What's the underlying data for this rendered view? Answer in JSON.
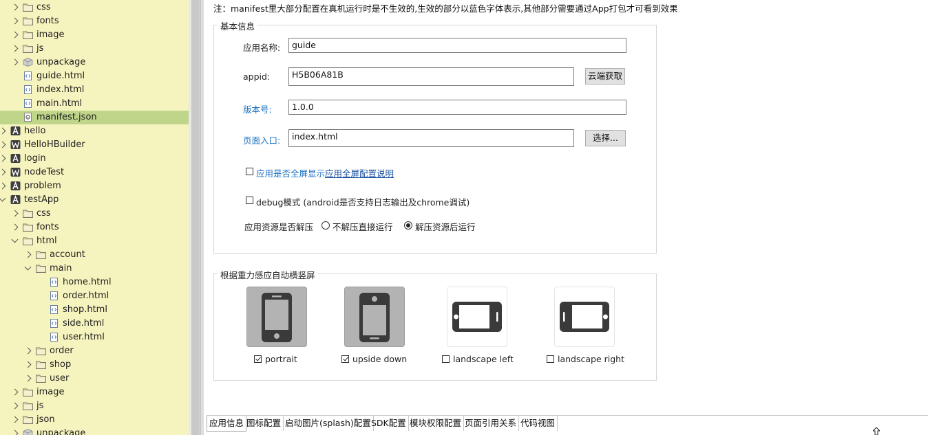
{
  "tree": {
    "items": [
      {
        "label": "css",
        "icon": "folder",
        "depth": 1,
        "arrow": "right"
      },
      {
        "label": "fonts",
        "icon": "folder",
        "depth": 1,
        "arrow": "right"
      },
      {
        "label": "image",
        "icon": "folder",
        "depth": 1,
        "arrow": "right"
      },
      {
        "label": "js",
        "icon": "folder",
        "depth": 1,
        "arrow": "right"
      },
      {
        "label": "unpackage",
        "icon": "package",
        "depth": 1,
        "arrow": "right"
      },
      {
        "label": "guide.html",
        "icon": "html-file",
        "depth": 1,
        "arrow": "none"
      },
      {
        "label": "index.html",
        "icon": "html-file",
        "depth": 1,
        "arrow": "none"
      },
      {
        "label": "main.html",
        "icon": "html-file",
        "depth": 1,
        "arrow": "none"
      },
      {
        "label": "manifest.json",
        "icon": "json-file",
        "depth": 1,
        "arrow": "none",
        "selected": true
      },
      {
        "label": "hello",
        "icon": "app-project",
        "depth": 0,
        "arrow": "right"
      },
      {
        "label": "HelloHBuilder",
        "icon": "web-project",
        "depth": 0,
        "arrow": "right"
      },
      {
        "label": "login",
        "icon": "app-project",
        "depth": 0,
        "arrow": "right"
      },
      {
        "label": "nodeTest",
        "icon": "web-project",
        "depth": 0,
        "arrow": "right"
      },
      {
        "label": "problem",
        "icon": "app-project",
        "depth": 0,
        "arrow": "right"
      },
      {
        "label": "testApp",
        "icon": "app-project",
        "depth": 0,
        "arrow": "down"
      },
      {
        "label": "css",
        "icon": "folder",
        "depth": 1,
        "arrow": "right"
      },
      {
        "label": "fonts",
        "icon": "folder",
        "depth": 1,
        "arrow": "right"
      },
      {
        "label": "html",
        "icon": "folder",
        "depth": 1,
        "arrow": "down"
      },
      {
        "label": "account",
        "icon": "folder",
        "depth": 2,
        "arrow": "right"
      },
      {
        "label": "main",
        "icon": "folder",
        "depth": 2,
        "arrow": "down"
      },
      {
        "label": "home.html",
        "icon": "html-file",
        "depth": 3,
        "arrow": "none"
      },
      {
        "label": "order.html",
        "icon": "html-file",
        "depth": 3,
        "arrow": "none"
      },
      {
        "label": "shop.html",
        "icon": "html-file",
        "depth": 3,
        "arrow": "none"
      },
      {
        "label": "side.html",
        "icon": "html-file",
        "depth": 3,
        "arrow": "none"
      },
      {
        "label": "user.html",
        "icon": "html-file",
        "depth": 3,
        "arrow": "none"
      },
      {
        "label": "order",
        "icon": "folder",
        "depth": 2,
        "arrow": "right"
      },
      {
        "label": "shop",
        "icon": "folder",
        "depth": 2,
        "arrow": "right"
      },
      {
        "label": "user",
        "icon": "folder",
        "depth": 2,
        "arrow": "right"
      },
      {
        "label": "image",
        "icon": "folder",
        "depth": 1,
        "arrow": "right"
      },
      {
        "label": "js",
        "icon": "folder",
        "depth": 1,
        "arrow": "right"
      },
      {
        "label": "json",
        "icon": "folder",
        "depth": 1,
        "arrow": "right"
      },
      {
        "label": "unpackage",
        "icon": "package",
        "depth": 1,
        "arrow": "right"
      }
    ]
  },
  "editor": {
    "note": "注：manifest里大部分配置在真机运行时是不生效的,生效的部分以蓝色字体表示,其他部分需要通过App打包才可看到效果",
    "basic": {
      "legend": "基本信息",
      "app_name_label": "应用名称:",
      "app_name_value": "guide",
      "appid_label": "appid:",
      "appid_value": "H5B06A81B",
      "cloud_button": "云端获取",
      "version_label": "版本号:",
      "version_value": "1.0.0",
      "entry_label": "页面入口:",
      "entry_value": "index.html",
      "choose_button": "选择...",
      "fullscreen_label": "应用是否全屏显示",
      "fullscreen_checked": false,
      "fullscreen_link": "应用全屏配置说明",
      "debug_label": "debug模式 (android是否支持日志输出及chrome调试)",
      "debug_checked": false,
      "unzip_label": "应用资源是否解压",
      "unzip_options": [
        "不解压直接运行",
        "解压资源后运行"
      ],
      "unzip_selected": "解压资源后运行"
    },
    "orientation": {
      "legend": "根据重力感应自动横竖屏",
      "options": [
        {
          "label": "portrait",
          "checked": true,
          "icon": "phone-portrait-icon"
        },
        {
          "label": "upside down",
          "checked": true,
          "icon": "phone-upside-down-icon"
        },
        {
          "label": "landscape left",
          "checked": false,
          "icon": "phone-landscape-left-icon"
        },
        {
          "label": "landscape right",
          "checked": false,
          "icon": "phone-landscape-right-icon"
        }
      ]
    },
    "tabs": [
      "应用信息",
      "图标配置",
      "启动图片(splash)配置",
      "SDK配置",
      "模块权限配置",
      "页面引用关系",
      "代码视图"
    ],
    "active_tab": "应用信息"
  },
  "colors": {
    "tree_bg": "#f6f4be",
    "tree_selected": "#bfd58a",
    "blue_label": "#1a6fc0",
    "tile_active": "#b3b3b3"
  }
}
